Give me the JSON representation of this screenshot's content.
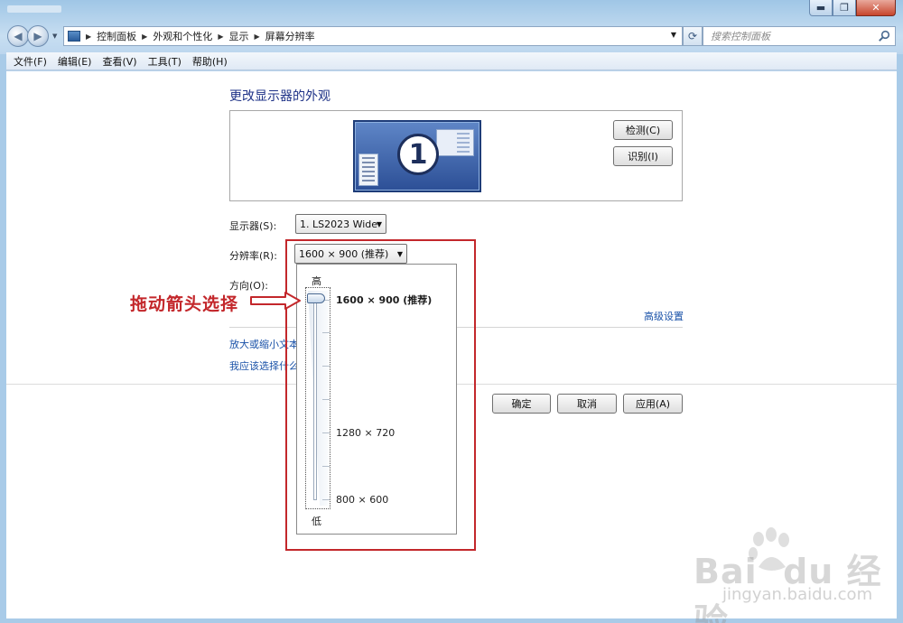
{
  "window": {
    "min_symbol": "▬",
    "max_symbol": "❐",
    "close_symbol": "✕"
  },
  "nav": {
    "back_symbol": "◀",
    "forward_symbol": "▶",
    "breadcrumbs": [
      "控制面板",
      "外观和个性化",
      "显示",
      "屏幕分辨率"
    ],
    "search_placeholder": "搜索控制面板"
  },
  "menu": [
    "文件(F)",
    "编辑(E)",
    "查看(V)",
    "工具(T)",
    "帮助(H)"
  ],
  "page": {
    "heading": "更改显示器的外观",
    "monitor_number": "1",
    "detect_button": "检测(C)",
    "identify_button": "识别(I)",
    "display_label": "显示器(S):",
    "display_value": "1. LS2023 Wide",
    "resolution_label": "分辨率(R):",
    "resolution_value": "1600 × 900 (推荐)",
    "orientation_label": "方向(O):",
    "advanced_link": "高级设置",
    "link_text_size": "放大或缩小文本",
    "link_which": "我应该选择什么",
    "ok_button": "确定",
    "cancel_button": "取消",
    "apply_button": "应用(A)"
  },
  "popup": {
    "high_label": "高",
    "low_label": "低",
    "options": [
      "1600 × 900 (推荐)",
      "1280 × 720",
      "800 × 600"
    ],
    "selected_option": "1600 × 900 (推荐)"
  },
  "annotation": {
    "text": "拖动箭头选择"
  },
  "watermark": {
    "brand": "Bai  du 经验",
    "url": "jingyan.baidu.com"
  },
  "colors": {
    "annotation": "#c3272b",
    "link": "#1a52a8",
    "heading": "#1e3287"
  }
}
